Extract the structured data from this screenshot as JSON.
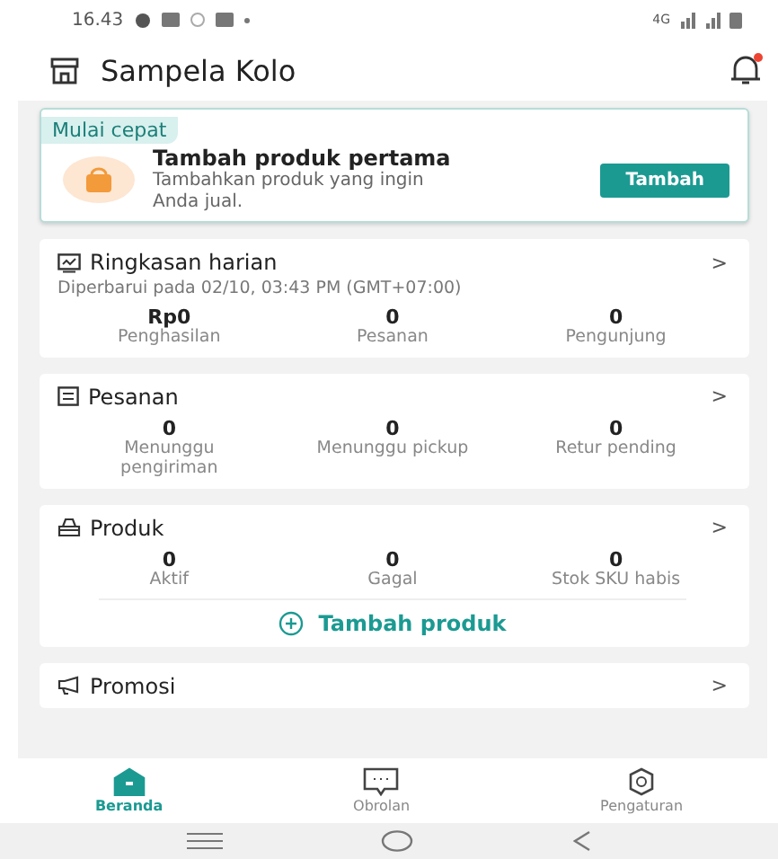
{
  "status_bar": {
    "time": "16.43",
    "network": "4G"
  },
  "header": {
    "title": "Sampela Kolo",
    "notification_dot": true
  },
  "quick_start": {
    "badge": "Mulai cepat",
    "title": "Tambah produk pertama",
    "description": "Tambahkan produk yang ingin Anda jual.",
    "button": "Tambah"
  },
  "sections": [
    {
      "kind": "chart",
      "title": "Ringkasan harian",
      "chevron": ">",
      "subtitle": "Diperbarui pada 02/10, 03:43 PM (GMT+07:00)",
      "stats": [
        {
          "value": "Rp0",
          "label": "Penghasilan"
        },
        {
          "value": "0",
          "label": "Pesanan"
        },
        {
          "value": "0",
          "label": "Pengunjung"
        }
      ]
    },
    {
      "kind": "list",
      "title": "Pesanan",
      "chevron": ">",
      "stats": [
        {
          "value": "0",
          "label": "Menunggu pengiriman"
        },
        {
          "value": "0",
          "label": "Menunggu pickup"
        },
        {
          "value": "0",
          "label": "Retur pending"
        }
      ]
    },
    {
      "kind": "bag",
      "title": "Produk",
      "chevron": ">",
      "stats": [
        {
          "value": "0",
          "label": "Aktif"
        },
        {
          "value": "0",
          "label": "Gagal"
        },
        {
          "value": "0",
          "label": "Stok SKU habis"
        }
      ],
      "action": "Tambah produk"
    },
    {
      "kind": "megaphone",
      "title": "Promosi",
      "chevron": ">"
    }
  ],
  "bottom_nav": [
    {
      "kind": "home",
      "label": "Beranda",
      "selected": true
    },
    {
      "kind": "chat",
      "label": "Obrolan",
      "selected": false
    },
    {
      "kind": "settings",
      "label": "Pengaturan",
      "selected": false
    }
  ]
}
